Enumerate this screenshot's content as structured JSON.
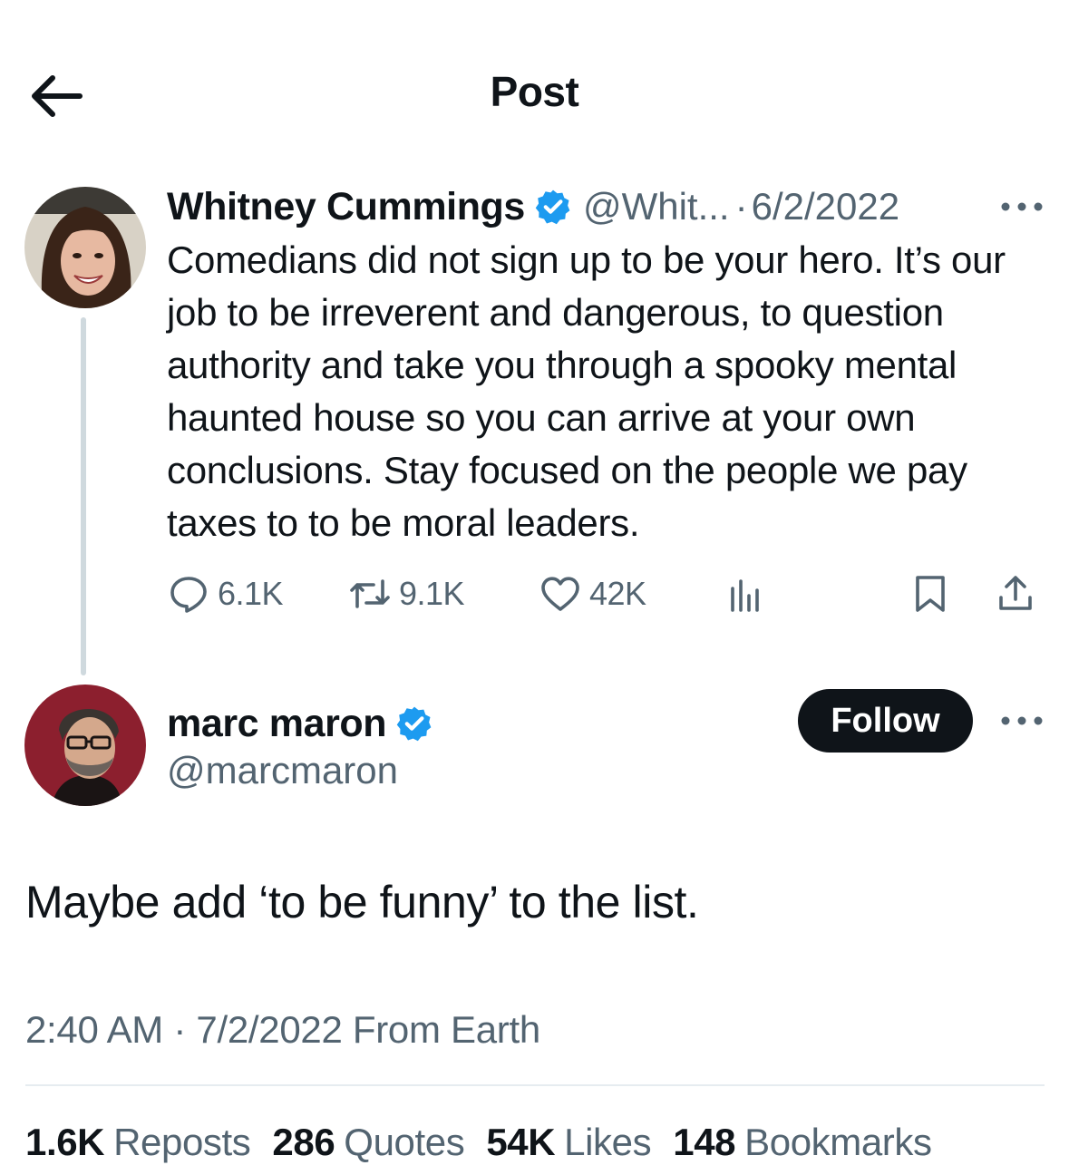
{
  "header": {
    "title": "Post"
  },
  "parent_post": {
    "author_name": "Whitney Cummings",
    "handle_truncated": "@Whit...",
    "separator": "·",
    "date": "6/2/2022",
    "text": "Comedians did not sign up to be your hero. It’s our job to be irreverent and dangerous, to question authority and take you through a spooky mental haunted house so you can arrive at your own conclusions. Stay focused on the people we pay taxes to to be moral leaders.",
    "replies": "6.1K",
    "reposts": "9.1K",
    "likes": "42K"
  },
  "main_post": {
    "author_name": "marc maron",
    "handle": "@marcmaron",
    "follow_label": "Follow",
    "text": "Maybe add ‘to be funny’ to the list.",
    "timestamp": "2:40 AM · 7/2/2022 From Earth"
  },
  "stats": [
    {
      "value": "1.6K",
      "label": "Reposts"
    },
    {
      "value": "286",
      "label": "Quotes"
    },
    {
      "value": "54K",
      "label": "Likes"
    },
    {
      "value": "148",
      "label": "Bookmarks"
    }
  ],
  "icons": {
    "back": "arrow-left-icon",
    "verified": "verified-badge-icon",
    "more": "more-horizontal-icon",
    "reply": "reply-icon",
    "repost": "repost-icon",
    "like": "heart-icon",
    "views": "analytics-icon",
    "bookmark": "bookmark-icon",
    "share": "share-icon"
  },
  "colors": {
    "verified": "#1d9bf0",
    "text": "#0f1419",
    "secondary": "#536471",
    "follow_bg": "#0f1419"
  }
}
